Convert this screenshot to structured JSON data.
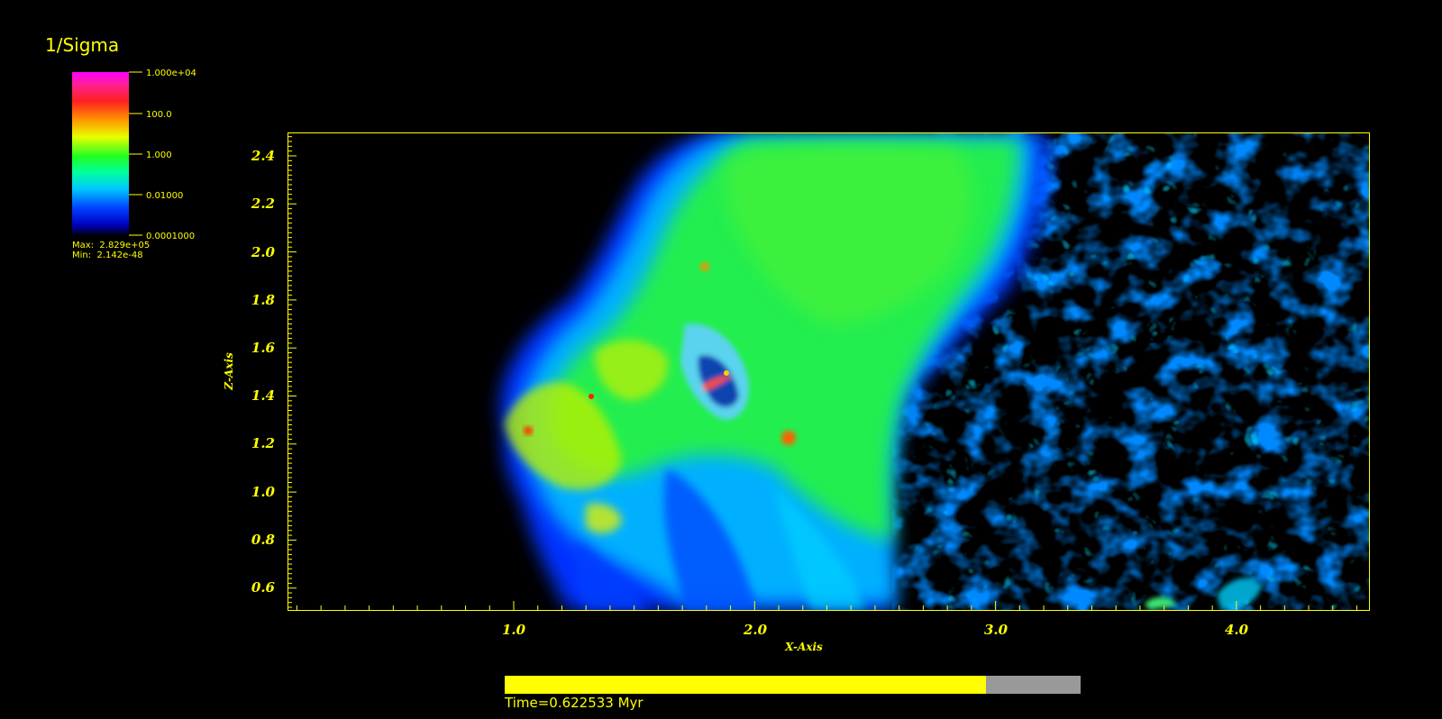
{
  "legend": {
    "title": "1/Sigma",
    "max_text": "Max:  2.829e+05",
    "min_text": "Min:  2.142e-48",
    "ticks": [
      "1.000e+04",
      "100.0",
      "1.000",
      "0.01000",
      "0.0001000"
    ]
  },
  "plot": {
    "xlabel": "X-Axis",
    "ylabel": "Z-Axis",
    "xticks": [
      "1.0",
      "2.0",
      "3.0",
      "4.0"
    ],
    "yticks": [
      "2.4",
      "2.2",
      "2.0",
      "1.8",
      "1.6",
      "1.4",
      "1.2",
      "1.0",
      "0.8",
      "0.6"
    ],
    "colors": {
      "axis": "#ffff00",
      "background": "#000000"
    }
  },
  "time": {
    "label": "Time=0.622533 Myr",
    "progress": 0.836
  }
}
